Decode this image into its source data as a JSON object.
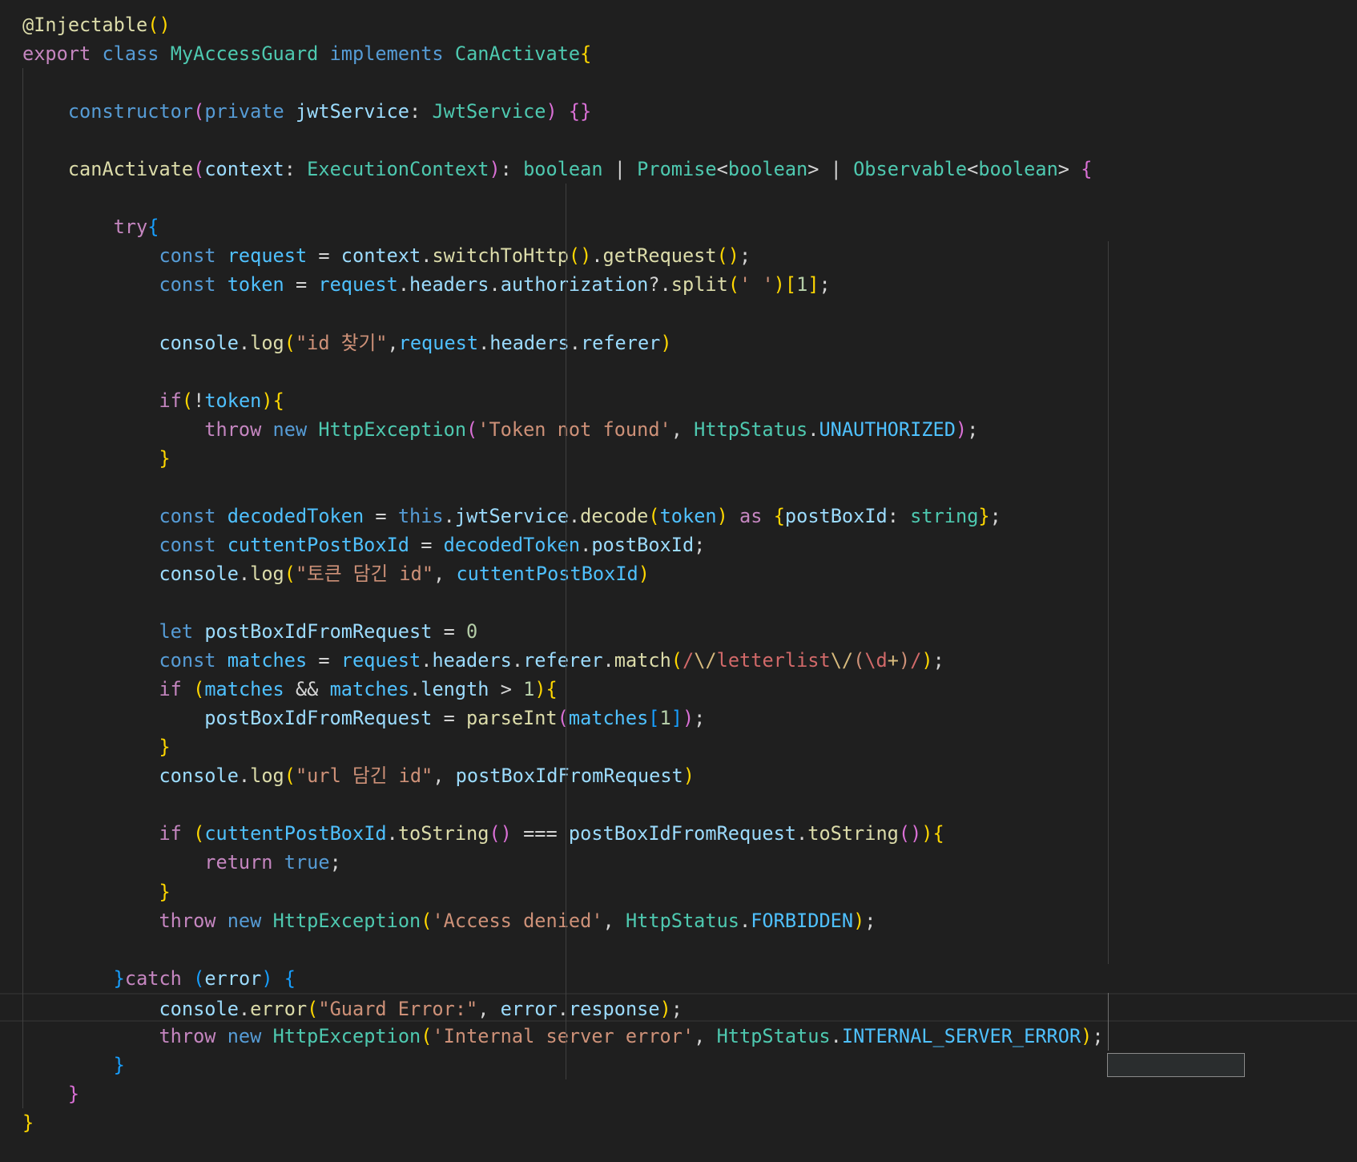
{
  "editor": {
    "language": "typescript",
    "theme_colors": {
      "background": "#1f1f1f",
      "keyword": "#c586c0",
      "storage": "#569cd6",
      "type": "#4ec9b0",
      "function": "#dcdcaa",
      "variable": "#9cdcfe",
      "constant": "#4fc1ff",
      "string": "#ce9178",
      "number": "#b5cea8",
      "regex": "#d16969",
      "punctuation": "#d4d4d4",
      "bracket_1": "#ffd700",
      "bracket_2": "#da70d6",
      "bracket_3": "#179fff"
    },
    "cursor_line": 34,
    "bracket_match": "catch-block-braces"
  },
  "code": {
    "lines": [
      [
        [
          "@Injectable",
          "#dcdcaa"
        ],
        [
          "()",
          "#ffd700"
        ]
      ],
      [
        [
          "export",
          "#c586c0"
        ],
        [
          " ",
          "#d4d4d4"
        ],
        [
          "class",
          "#569cd6"
        ],
        [
          " ",
          "#d4d4d4"
        ],
        [
          "MyAccessGuard",
          "#4ec9b0"
        ],
        [
          " ",
          "#d4d4d4"
        ],
        [
          "implements",
          "#569cd6"
        ],
        [
          " ",
          "#d4d4d4"
        ],
        [
          "CanActivate",
          "#4ec9b0"
        ],
        [
          "{",
          "#ffd700"
        ]
      ],
      [],
      [
        [
          "    ",
          "#d4d4d4"
        ],
        [
          "constructor",
          "#569cd6"
        ],
        [
          "(",
          "#da70d6"
        ],
        [
          "private",
          "#569cd6"
        ],
        [
          " ",
          "#d4d4d4"
        ],
        [
          "jwtService",
          "#9cdcfe"
        ],
        [
          ": ",
          "#d4d4d4"
        ],
        [
          "JwtService",
          "#4ec9b0"
        ],
        [
          ")",
          "#da70d6"
        ],
        [
          " ",
          "#d4d4d4"
        ],
        [
          "{}",
          "#da70d6"
        ]
      ],
      [],
      [
        [
          "    ",
          "#d4d4d4"
        ],
        [
          "canActivate",
          "#dcdcaa"
        ],
        [
          "(",
          "#da70d6"
        ],
        [
          "context",
          "#9cdcfe"
        ],
        [
          ": ",
          "#d4d4d4"
        ],
        [
          "ExecutionContext",
          "#4ec9b0"
        ],
        [
          ")",
          "#da70d6"
        ],
        [
          ": ",
          "#d4d4d4"
        ],
        [
          "boolean",
          "#4ec9b0"
        ],
        [
          " | ",
          "#d4d4d4"
        ],
        [
          "Promise",
          "#4ec9b0"
        ],
        [
          "<",
          "#d4d4d4"
        ],
        [
          "boolean",
          "#4ec9b0"
        ],
        [
          "> | ",
          "#d4d4d4"
        ],
        [
          "Observable",
          "#4ec9b0"
        ],
        [
          "<",
          "#d4d4d4"
        ],
        [
          "boolean",
          "#4ec9b0"
        ],
        [
          "> ",
          "#d4d4d4"
        ],
        [
          "{",
          "#da70d6"
        ]
      ],
      [],
      [
        [
          "        ",
          "#d4d4d4"
        ],
        [
          "try",
          "#c586c0"
        ],
        [
          "{",
          "#179fff"
        ]
      ],
      [
        [
          "            ",
          "#d4d4d4"
        ],
        [
          "const",
          "#569cd6"
        ],
        [
          " ",
          "#d4d4d4"
        ],
        [
          "request",
          "#4fc1ff"
        ],
        [
          " = ",
          "#d4d4d4"
        ],
        [
          "context",
          "#9cdcfe"
        ],
        [
          ".",
          "#d4d4d4"
        ],
        [
          "switchToHttp",
          "#dcdcaa"
        ],
        [
          "()",
          "#ffd700"
        ],
        [
          ".",
          "#d4d4d4"
        ],
        [
          "getRequest",
          "#dcdcaa"
        ],
        [
          "()",
          "#ffd700"
        ],
        [
          ";",
          "#d4d4d4"
        ]
      ],
      [
        [
          "            ",
          "#d4d4d4"
        ],
        [
          "const",
          "#569cd6"
        ],
        [
          " ",
          "#d4d4d4"
        ],
        [
          "token",
          "#4fc1ff"
        ],
        [
          " = ",
          "#d4d4d4"
        ],
        [
          "request",
          "#4fc1ff"
        ],
        [
          ".",
          "#d4d4d4"
        ],
        [
          "headers",
          "#9cdcfe"
        ],
        [
          ".",
          "#d4d4d4"
        ],
        [
          "authorization",
          "#9cdcfe"
        ],
        [
          "?.",
          "#d4d4d4"
        ],
        [
          "split",
          "#dcdcaa"
        ],
        [
          "(",
          "#ffd700"
        ],
        [
          "' '",
          "#ce9178"
        ],
        [
          ")",
          "#ffd700"
        ],
        [
          "[",
          "#ffd700"
        ],
        [
          "1",
          "#b5cea8"
        ],
        [
          "]",
          "#ffd700"
        ],
        [
          ";",
          "#d4d4d4"
        ]
      ],
      [],
      [
        [
          "            ",
          "#d4d4d4"
        ],
        [
          "console",
          "#9cdcfe"
        ],
        [
          ".",
          "#d4d4d4"
        ],
        [
          "log",
          "#dcdcaa"
        ],
        [
          "(",
          "#ffd700"
        ],
        [
          "\"id 찾기\"",
          "#ce9178"
        ],
        [
          ",",
          "#d4d4d4"
        ],
        [
          "request",
          "#4fc1ff"
        ],
        [
          ".",
          "#d4d4d4"
        ],
        [
          "headers",
          "#9cdcfe"
        ],
        [
          ".",
          "#d4d4d4"
        ],
        [
          "referer",
          "#9cdcfe"
        ],
        [
          ")",
          "#ffd700"
        ]
      ],
      [],
      [
        [
          "            ",
          "#d4d4d4"
        ],
        [
          "if",
          "#c586c0"
        ],
        [
          "(",
          "#ffd700"
        ],
        [
          "!",
          "#d4d4d4"
        ],
        [
          "token",
          "#4fc1ff"
        ],
        [
          "){",
          "#ffd700"
        ]
      ],
      [
        [
          "                ",
          "#d4d4d4"
        ],
        [
          "throw",
          "#c586c0"
        ],
        [
          " ",
          "#d4d4d4"
        ],
        [
          "new",
          "#569cd6"
        ],
        [
          " ",
          "#d4d4d4"
        ],
        [
          "HttpException",
          "#4ec9b0"
        ],
        [
          "(",
          "#da70d6"
        ],
        [
          "'Token not found'",
          "#ce9178"
        ],
        [
          ", ",
          "#d4d4d4"
        ],
        [
          "HttpStatus",
          "#4ec9b0"
        ],
        [
          ".",
          "#d4d4d4"
        ],
        [
          "UNAUTHORIZED",
          "#4fc1ff"
        ],
        [
          ")",
          "#da70d6"
        ],
        [
          ";",
          "#d4d4d4"
        ]
      ],
      [
        [
          "            ",
          "#d4d4d4"
        ],
        [
          "}",
          "#ffd700"
        ]
      ],
      [],
      [
        [
          "            ",
          "#d4d4d4"
        ],
        [
          "const",
          "#569cd6"
        ],
        [
          " ",
          "#d4d4d4"
        ],
        [
          "decodedToken",
          "#4fc1ff"
        ],
        [
          " = ",
          "#d4d4d4"
        ],
        [
          "this",
          "#569cd6"
        ],
        [
          ".",
          "#d4d4d4"
        ],
        [
          "jwtService",
          "#9cdcfe"
        ],
        [
          ".",
          "#d4d4d4"
        ],
        [
          "decode",
          "#dcdcaa"
        ],
        [
          "(",
          "#ffd700"
        ],
        [
          "token",
          "#4fc1ff"
        ],
        [
          ")",
          "#ffd700"
        ],
        [
          " ",
          "#d4d4d4"
        ],
        [
          "as",
          "#c586c0"
        ],
        [
          " ",
          "#d4d4d4"
        ],
        [
          "{",
          "#ffd700"
        ],
        [
          "postBoxId",
          "#9cdcfe"
        ],
        [
          ": ",
          "#d4d4d4"
        ],
        [
          "string",
          "#4ec9b0"
        ],
        [
          "}",
          "#ffd700"
        ],
        [
          ";",
          "#d4d4d4"
        ]
      ],
      [
        [
          "            ",
          "#d4d4d4"
        ],
        [
          "const",
          "#569cd6"
        ],
        [
          " ",
          "#d4d4d4"
        ],
        [
          "cuttentPostBoxId",
          "#4fc1ff"
        ],
        [
          " = ",
          "#d4d4d4"
        ],
        [
          "decodedToken",
          "#4fc1ff"
        ],
        [
          ".",
          "#d4d4d4"
        ],
        [
          "postBoxId",
          "#9cdcfe"
        ],
        [
          ";",
          "#d4d4d4"
        ]
      ],
      [
        [
          "            ",
          "#d4d4d4"
        ],
        [
          "console",
          "#9cdcfe"
        ],
        [
          ".",
          "#d4d4d4"
        ],
        [
          "log",
          "#dcdcaa"
        ],
        [
          "(",
          "#ffd700"
        ],
        [
          "\"토큰 담긴 id\"",
          "#ce9178"
        ],
        [
          ", ",
          "#d4d4d4"
        ],
        [
          "cuttentPostBoxId",
          "#4fc1ff"
        ],
        [
          ")",
          "#ffd700"
        ]
      ],
      [],
      [
        [
          "            ",
          "#d4d4d4"
        ],
        [
          "let",
          "#569cd6"
        ],
        [
          " ",
          "#d4d4d4"
        ],
        [
          "postBoxIdFromRequest",
          "#9cdcfe"
        ],
        [
          " = ",
          "#d4d4d4"
        ],
        [
          "0",
          "#b5cea8"
        ]
      ],
      [
        [
          "            ",
          "#d4d4d4"
        ],
        [
          "const",
          "#569cd6"
        ],
        [
          " ",
          "#d4d4d4"
        ],
        [
          "matches",
          "#4fc1ff"
        ],
        [
          " = ",
          "#d4d4d4"
        ],
        [
          "request",
          "#4fc1ff"
        ],
        [
          ".",
          "#d4d4d4"
        ],
        [
          "headers",
          "#9cdcfe"
        ],
        [
          ".",
          "#d4d4d4"
        ],
        [
          "referer",
          "#9cdcfe"
        ],
        [
          ".",
          "#d4d4d4"
        ],
        [
          "match",
          "#dcdcaa"
        ],
        [
          "(",
          "#ffd700"
        ],
        [
          "/",
          "#d16969"
        ],
        [
          "\\/",
          "#d7ba7d"
        ],
        [
          "letterlist",
          "#d16969"
        ],
        [
          "\\/",
          "#d7ba7d"
        ],
        [
          "(",
          "#ce9178"
        ],
        [
          "\\d",
          "#d16969"
        ],
        [
          "+",
          "#d7ba7d"
        ],
        [
          ")",
          "#ce9178"
        ],
        [
          "/",
          "#d16969"
        ],
        [
          ")",
          "#ffd700"
        ],
        [
          ";",
          "#d4d4d4"
        ]
      ],
      [
        [
          "            ",
          "#d4d4d4"
        ],
        [
          "if",
          "#c586c0"
        ],
        [
          " ",
          "#d4d4d4"
        ],
        [
          "(",
          "#ffd700"
        ],
        [
          "matches",
          "#4fc1ff"
        ],
        [
          " && ",
          "#d4d4d4"
        ],
        [
          "matches",
          "#4fc1ff"
        ],
        [
          ".",
          "#d4d4d4"
        ],
        [
          "length",
          "#9cdcfe"
        ],
        [
          " > ",
          "#d4d4d4"
        ],
        [
          "1",
          "#b5cea8"
        ],
        [
          "){",
          "#ffd700"
        ]
      ],
      [
        [
          "                ",
          "#d4d4d4"
        ],
        [
          "postBoxIdFromRequest",
          "#9cdcfe"
        ],
        [
          " = ",
          "#d4d4d4"
        ],
        [
          "parseInt",
          "#dcdcaa"
        ],
        [
          "(",
          "#da70d6"
        ],
        [
          "matches",
          "#4fc1ff"
        ],
        [
          "[",
          "#179fff"
        ],
        [
          "1",
          "#b5cea8"
        ],
        [
          "]",
          "#179fff"
        ],
        [
          ")",
          "#da70d6"
        ],
        [
          ";",
          "#d4d4d4"
        ]
      ],
      [
        [
          "            ",
          "#d4d4d4"
        ],
        [
          "}",
          "#ffd700"
        ]
      ],
      [
        [
          "            ",
          "#d4d4d4"
        ],
        [
          "console",
          "#9cdcfe"
        ],
        [
          ".",
          "#d4d4d4"
        ],
        [
          "log",
          "#dcdcaa"
        ],
        [
          "(",
          "#ffd700"
        ],
        [
          "\"url 담긴 id\"",
          "#ce9178"
        ],
        [
          ", ",
          "#d4d4d4"
        ],
        [
          "postBoxIdFromRequest",
          "#9cdcfe"
        ],
        [
          ")",
          "#ffd700"
        ]
      ],
      [],
      [
        [
          "            ",
          "#d4d4d4"
        ],
        [
          "if",
          "#c586c0"
        ],
        [
          " ",
          "#d4d4d4"
        ],
        [
          "(",
          "#ffd700"
        ],
        [
          "cuttentPostBoxId",
          "#4fc1ff"
        ],
        [
          ".",
          "#d4d4d4"
        ],
        [
          "toString",
          "#dcdcaa"
        ],
        [
          "()",
          "#da70d6"
        ],
        [
          " === ",
          "#d4d4d4"
        ],
        [
          "postBoxIdFromRequest",
          "#9cdcfe"
        ],
        [
          ".",
          "#d4d4d4"
        ],
        [
          "toString",
          "#dcdcaa"
        ],
        [
          "()",
          "#da70d6"
        ],
        [
          "){",
          "#ffd700"
        ]
      ],
      [
        [
          "                ",
          "#d4d4d4"
        ],
        [
          "return",
          "#c586c0"
        ],
        [
          " ",
          "#d4d4d4"
        ],
        [
          "true",
          "#569cd6"
        ],
        [
          ";",
          "#d4d4d4"
        ]
      ],
      [
        [
          "            ",
          "#d4d4d4"
        ],
        [
          "}",
          "#ffd700"
        ]
      ],
      [
        [
          "            ",
          "#d4d4d4"
        ],
        [
          "throw",
          "#c586c0"
        ],
        [
          " ",
          "#d4d4d4"
        ],
        [
          "new",
          "#569cd6"
        ],
        [
          " ",
          "#d4d4d4"
        ],
        [
          "HttpException",
          "#4ec9b0"
        ],
        [
          "(",
          "#ffd700"
        ],
        [
          "'Access denied'",
          "#ce9178"
        ],
        [
          ", ",
          "#d4d4d4"
        ],
        [
          "HttpStatus",
          "#4ec9b0"
        ],
        [
          ".",
          "#d4d4d4"
        ],
        [
          "FORBIDDEN",
          "#4fc1ff"
        ],
        [
          ")",
          "#ffd700"
        ],
        [
          ";",
          "#d4d4d4"
        ]
      ],
      [],
      [
        [
          "        ",
          "#d4d4d4"
        ],
        [
          "}",
          "#179fff"
        ],
        [
          "catch",
          "#c586c0"
        ],
        [
          " ",
          "#d4d4d4"
        ],
        [
          "(",
          "#179fff"
        ],
        [
          "error",
          "#9cdcfe"
        ],
        [
          ")",
          "#179fff"
        ],
        [
          " ",
          "#d4d4d4"
        ],
        [
          "{",
          "#179fff"
        ]
      ],
      [
        [
          "            ",
          "#d4d4d4"
        ],
        [
          "console",
          "#9cdcfe"
        ],
        [
          ".",
          "#d4d4d4"
        ],
        [
          "error",
          "#dcdcaa"
        ],
        [
          "(",
          "#ffd700"
        ],
        [
          "\"Guard Error:\"",
          "#ce9178"
        ],
        [
          ", ",
          "#d4d4d4"
        ],
        [
          "error",
          "#9cdcfe"
        ],
        [
          ".",
          "#d4d4d4"
        ],
        [
          "response",
          "#9cdcfe"
        ],
        [
          ")",
          "#ffd700"
        ],
        [
          ";",
          "#d4d4d4"
        ]
      ],
      [
        [
          "            ",
          "#d4d4d4"
        ],
        [
          "throw",
          "#c586c0"
        ],
        [
          " ",
          "#d4d4d4"
        ],
        [
          "new",
          "#569cd6"
        ],
        [
          " ",
          "#d4d4d4"
        ],
        [
          "HttpException",
          "#4ec9b0"
        ],
        [
          "(",
          "#ffd700"
        ],
        [
          "'Internal server error'",
          "#ce9178"
        ],
        [
          ", ",
          "#d4d4d4"
        ],
        [
          "HttpStatus",
          "#4ec9b0"
        ],
        [
          ".",
          "#d4d4d4"
        ],
        [
          "INTERNAL_SERVER_ERROR",
          "#4fc1ff"
        ],
        [
          ")",
          "#ffd700"
        ],
        [
          ";",
          "#d4d4d4"
        ]
      ],
      [
        [
          "        ",
          "#d4d4d4"
        ],
        [
          "}",
          "#179fff"
        ]
      ],
      [
        [
          "    ",
          "#d4d4d4"
        ],
        [
          "}",
          "#da70d6"
        ]
      ],
      [
        [
          "}",
          "#ffd700"
        ]
      ]
    ]
  }
}
